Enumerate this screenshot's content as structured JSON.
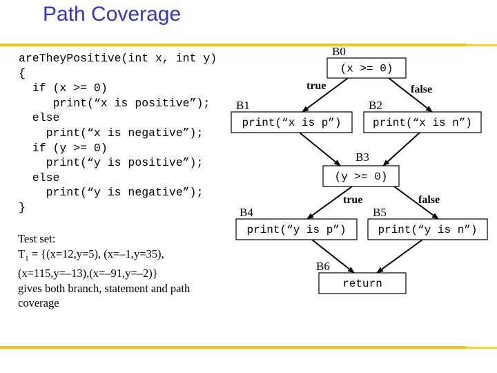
{
  "slide": {
    "title": "Path Coverage",
    "accent_color": "#f5c518",
    "title_color": "#3333cc"
  },
  "code": {
    "lines": [
      "areTheyPositive(int x, int y)",
      "{",
      "  if (x >= 0)",
      "     print(“x is positive”);",
      "  else",
      "    print(“x is negative”);",
      "  if (y >= 0)",
      "    print(“y is positive”);",
      "  else",
      "    print(“y is negative”);",
      "}"
    ]
  },
  "test_set": {
    "heading": "Test set:",
    "name": "T",
    "subscript": "1",
    "line1_rest": " = {(x=12,y=5), (x=–1,y=35),",
    "line2": "(x=115,y=–13),(x=–91,y=–2)}",
    "line3": "gives both branch, statement and path",
    "line4": "coverage"
  },
  "cfg": {
    "blocks": [
      {
        "id": "B0",
        "label": "B0",
        "text": "(x >= 0)"
      },
      {
        "id": "B1",
        "label": "B1",
        "text": "print(“x is p”)"
      },
      {
        "id": "B2",
        "label": "B2",
        "text": "print(“x is n”)"
      },
      {
        "id": "B3",
        "label": "B3",
        "text": "(y >= 0)"
      },
      {
        "id": "B4",
        "label": "B4",
        "text": "print(“y is p”)"
      },
      {
        "id": "B5",
        "label": "B5",
        "text": "print(“y is n”)"
      },
      {
        "id": "B6",
        "label": "B6",
        "text": "return"
      }
    ],
    "edges": [
      {
        "from": "B0",
        "to": "B1",
        "label": "true"
      },
      {
        "from": "B0",
        "to": "B2",
        "label": "false"
      },
      {
        "from": "B1",
        "to": "B3",
        "label": ""
      },
      {
        "from": "B2",
        "to": "B3",
        "label": ""
      },
      {
        "from": "B3",
        "to": "B4",
        "label": "true"
      },
      {
        "from": "B3",
        "to": "B5",
        "label": "false"
      },
      {
        "from": "B4",
        "to": "B6",
        "label": ""
      },
      {
        "from": "B5",
        "to": "B6",
        "label": ""
      }
    ]
  }
}
